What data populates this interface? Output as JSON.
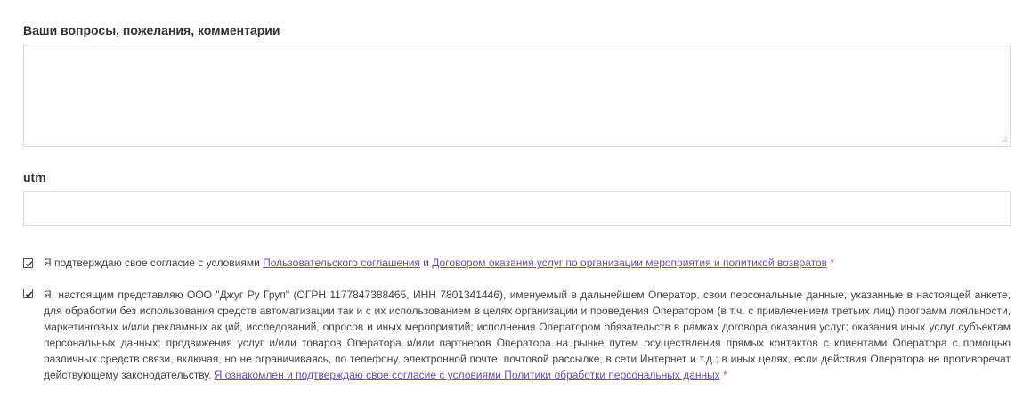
{
  "form": {
    "comments": {
      "label": "Ваши вопросы, пожелания, комментарии",
      "value": ""
    },
    "utm": {
      "label": "utm",
      "value": ""
    },
    "consent_terms": {
      "checked": true,
      "text_before": "Я подтверждаю свое согласие с условиями ",
      "link_user_agreement": "Пользовательского соглашения",
      "text_and": " и ",
      "link_contract": "Договором оказания услуг по организации мероприятия и политикой возвратов",
      "required_mark": "*"
    },
    "consent_personal_data": {
      "checked": true,
      "text": "Я, настоящим представляю ООО \"Джуг Ру Груп\" (ОГРН 1177847388465, ИНН 7801341446), именуемый в дальнейшем Оператор, свои персональные данные, указанные в настоящей анкете, для обработки без использования средств автоматизации так и с их использованием в целях организации и проведения Оператором (в т.ч. с привлечением третьих лиц) программ лояльности, маркетинговых и/или рекламных акций, исследований, опросов и иных мероприятий; исполнения Оператором обязательств в рамках договора оказания услуг; оказания иных услуг субъектам персональных данных; продвижения услуг и/или товаров Оператора и/или партнеров Оператора на рынке путем осуществления прямых контактов с клиентами Оператора с помощью различных средств связи, включая, но не ограничиваясь, по телефону, электронной почте, почтовой рассылке, в сети Интернет и т.д.; в иных целях, если действия Оператора не противоречат действующему законодательству.",
      "link_policy": "Я ознакомлен и подтверждаю свое согласие с условиями Политики обработки персональных данных",
      "required_mark": "*"
    }
  },
  "colors": {
    "link": "#6b4fb0",
    "required": "#d9534f",
    "border": "#dcdcdc"
  }
}
